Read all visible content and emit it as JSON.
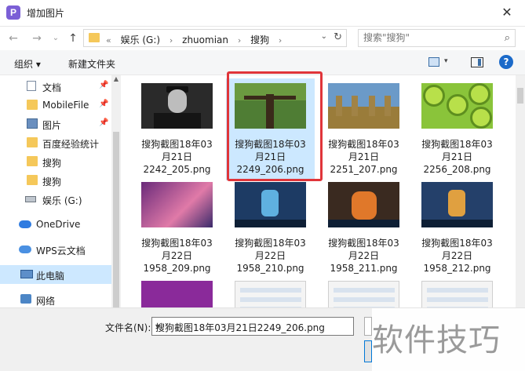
{
  "window": {
    "title": "增加图片",
    "app_icon_letter": "P",
    "close_glyph": "✕"
  },
  "nav": {
    "back_glyph": "←",
    "forward_glyph": "→",
    "recent_glyph": "⌄",
    "up_glyph": "↑",
    "breadcrumb": [
      "«",
      "娱乐 (G:)",
      "›",
      "zhuomian",
      "›",
      "搜狗",
      "›"
    ],
    "dropdown_glyph": "⌄",
    "refresh_glyph": "↻",
    "search_placeholder": "搜索\"搜狗\"",
    "search_glyph": "⌕"
  },
  "toolbar": {
    "organize_label": "组织 ▾",
    "new_folder_label": "新建文件夹",
    "help_glyph": "?",
    "view_dd_glyph": "▾"
  },
  "sidebar": {
    "scroll_up_glyph": "▲",
    "items": [
      {
        "label": "文档",
        "icon": "document-icon",
        "pinned": true
      },
      {
        "label": "MobileFile",
        "icon": "folder-icon",
        "pinned": true
      },
      {
        "label": "图片",
        "icon": "pictures-icon",
        "pinned": true
      },
      {
        "label": "百度经验统计",
        "icon": "folder-icon",
        "pinned": false
      },
      {
        "label": "搜狗",
        "icon": "folder-icon",
        "pinned": false
      },
      {
        "label": "搜狗",
        "icon": "folder-icon",
        "pinned": false
      },
      {
        "label": "娱乐 (G:)",
        "icon": "drive-icon",
        "pinned": false
      },
      {
        "label": "OneDrive",
        "icon": "cloud-icon",
        "pinned": false
      },
      {
        "label": "WPS云文档",
        "icon": "cloud-icon",
        "pinned": false
      },
      {
        "label": "此电脑",
        "icon": "computer-icon",
        "pinned": false,
        "selected": true
      },
      {
        "label": "网络",
        "icon": "network-icon",
        "pinned": false
      }
    ],
    "pin_glyph": "📌"
  },
  "files": [
    {
      "name": "搜狗截图18年03月21日2242_205.png",
      "lines": [
        "搜狗截图18年03",
        "月21日",
        "2242_205.png"
      ]
    },
    {
      "name": "搜狗截图18年03月21日2249_206.png",
      "lines": [
        "搜狗截图18年03",
        "月21日",
        "2249_206.png"
      ],
      "selected": true
    },
    {
      "name": "搜狗截图18年03月21日2251_207.png",
      "lines": [
        "搜狗截图18年03",
        "月21日",
        "2251_207.png"
      ]
    },
    {
      "name": "搜狗截图18年03月21日2256_208.png",
      "lines": [
        "搜狗截图18年03",
        "月21日",
        "2256_208.png"
      ]
    },
    {
      "name": "搜狗截图18年03月22日1958_209.png",
      "lines": [
        "搜狗截图18年03",
        "月22日",
        "1958_209.png"
      ]
    },
    {
      "name": "搜狗截图18年03月22日1958_210.png",
      "lines": [
        "搜狗截图18年03",
        "月22日",
        "1958_210.png"
      ]
    },
    {
      "name": "搜狗截图18年03月22日1958_211.png",
      "lines": [
        "搜狗截图18年03",
        "月22日",
        "1958_211.png"
      ]
    },
    {
      "name": "搜狗截图18年03月22日1958_212.png",
      "lines": [
        "搜狗截图18年03",
        "月22日",
        "1958_212.png"
      ]
    }
  ],
  "bottom": {
    "filename_label": "文件名(N):",
    "filename_value": "搜狗截图18年03月21日2249_206.png",
    "dropdown_glyph": "▾"
  },
  "watermark": {
    "text": "软件技巧"
  },
  "colors": {
    "selection": "#cce8ff",
    "highlight_border": "#e0353a",
    "help": "#1b6ac9"
  }
}
